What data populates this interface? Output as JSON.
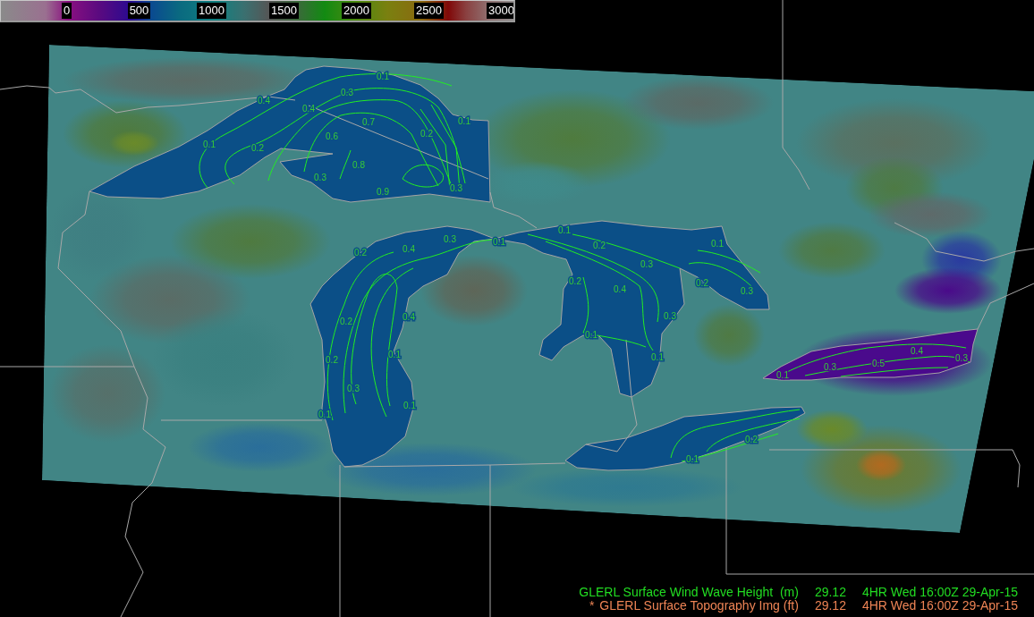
{
  "colorbar": {
    "labels": [
      "0",
      "500",
      "1000",
      "1500",
      "2000",
      "2500",
      "3000"
    ]
  },
  "map": {
    "contour_labels": [
      "0.1",
      "0.3",
      "0.4",
      "0.4",
      "0.7",
      "0.1",
      "0.2",
      "0.6",
      "0.1",
      "0.2",
      "0.8",
      "0.3",
      "0.9",
      "0.3",
      "0.2",
      "0.4",
      "0.3",
      "0.1",
      "0.1",
      "0.2",
      "0.1",
      "0.3",
      "0.2",
      "0.4",
      "0.2",
      "0.3",
      "0.2",
      "0.4",
      "0.3",
      "0.1",
      "0.1",
      "0.2",
      "0.1",
      "0.3",
      "0.1",
      "0.1",
      "0.1",
      "0.3",
      "0.5",
      "0.4",
      "0.3",
      "0.2",
      "0.1"
    ]
  },
  "legend": [
    {
      "name": "GLERL Surface Wind Wave Height  (m)",
      "value": "29.12",
      "time": "4HR Wed 16:00Z 29-Apr-15",
      "color": "#22dd22"
    },
    {
      "marker": "*",
      "name": "GLERL Surface Topography Img (ft)",
      "value": "29.12",
      "time": "4HR Wed 16:00Z 29-Apr-15",
      "color": "#ee8455"
    }
  ]
}
